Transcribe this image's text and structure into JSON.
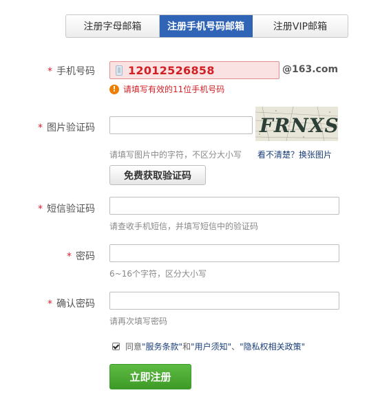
{
  "tabs": [
    {
      "label": "注册字母邮箱"
    },
    {
      "label": "注册手机号码邮箱"
    },
    {
      "label": "注册VIP邮箱"
    }
  ],
  "form": {
    "phone": {
      "label": "手机号码",
      "value": "12012526858",
      "suffix": "@163.com",
      "error": "请填写有效的11位手机号码"
    },
    "captcha": {
      "label": "图片验证码",
      "value": "",
      "hint": "请填写图片中的字符，不区分大小写",
      "refresh": "看不清楚？换张图片",
      "image_text": "FRNXS"
    },
    "sms_button": "免费获取验证码",
    "sms": {
      "label": "短信验证码",
      "value": "",
      "hint": "请查收手机短信，并填写短信中的验证码"
    },
    "password": {
      "label": "密码",
      "value": "",
      "hint": "6~16个字符，区分大小写"
    },
    "confirm": {
      "label": "确认密码",
      "value": "",
      "hint": "请再次填写密码"
    }
  },
  "agreement": {
    "checked": true,
    "prefix": "同意",
    "terms": "\"服务条款\"",
    "and": "和",
    "notice": "\"用户须知\"",
    "sep": "、",
    "privacy": "\"隐私权相关政策\""
  },
  "submit": "立即注册",
  "colors": {
    "active_tab": "#2f64b6",
    "error": "#d21f24",
    "submit": "#4aa934",
    "link": "#1a3e7a"
  }
}
